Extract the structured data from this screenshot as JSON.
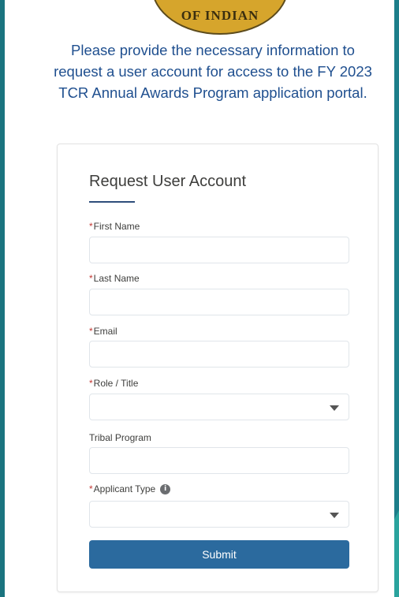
{
  "seal": {
    "text": "OF INDIAN"
  },
  "intro": {
    "text": "Please provide the necessary information to request a user account for access to the FY 2023 TCR Annual Awards Program application portal."
  },
  "form": {
    "title": "Request User Account",
    "required_marker": "*",
    "fields": {
      "first_name": {
        "label": "First Name",
        "required": true,
        "value": ""
      },
      "last_name": {
        "label": "Last Name",
        "required": true,
        "value": ""
      },
      "email": {
        "label": "Email",
        "required": true,
        "value": ""
      },
      "role_title": {
        "label": "Role / Title",
        "required": true,
        "value": ""
      },
      "tribal_program": {
        "label": "Tribal Program",
        "required": false,
        "value": ""
      },
      "applicant_type": {
        "label": "Applicant Type",
        "required": true,
        "value": "",
        "info_icon": "info-icon"
      }
    },
    "submit_label": "Submit"
  },
  "colors": {
    "background": "#1d7e8a",
    "accent_shape": "#2aa39d",
    "intro_text": "#1f4f8f",
    "submit_button": "#2b6a9e",
    "required_marker": "#c23934"
  }
}
